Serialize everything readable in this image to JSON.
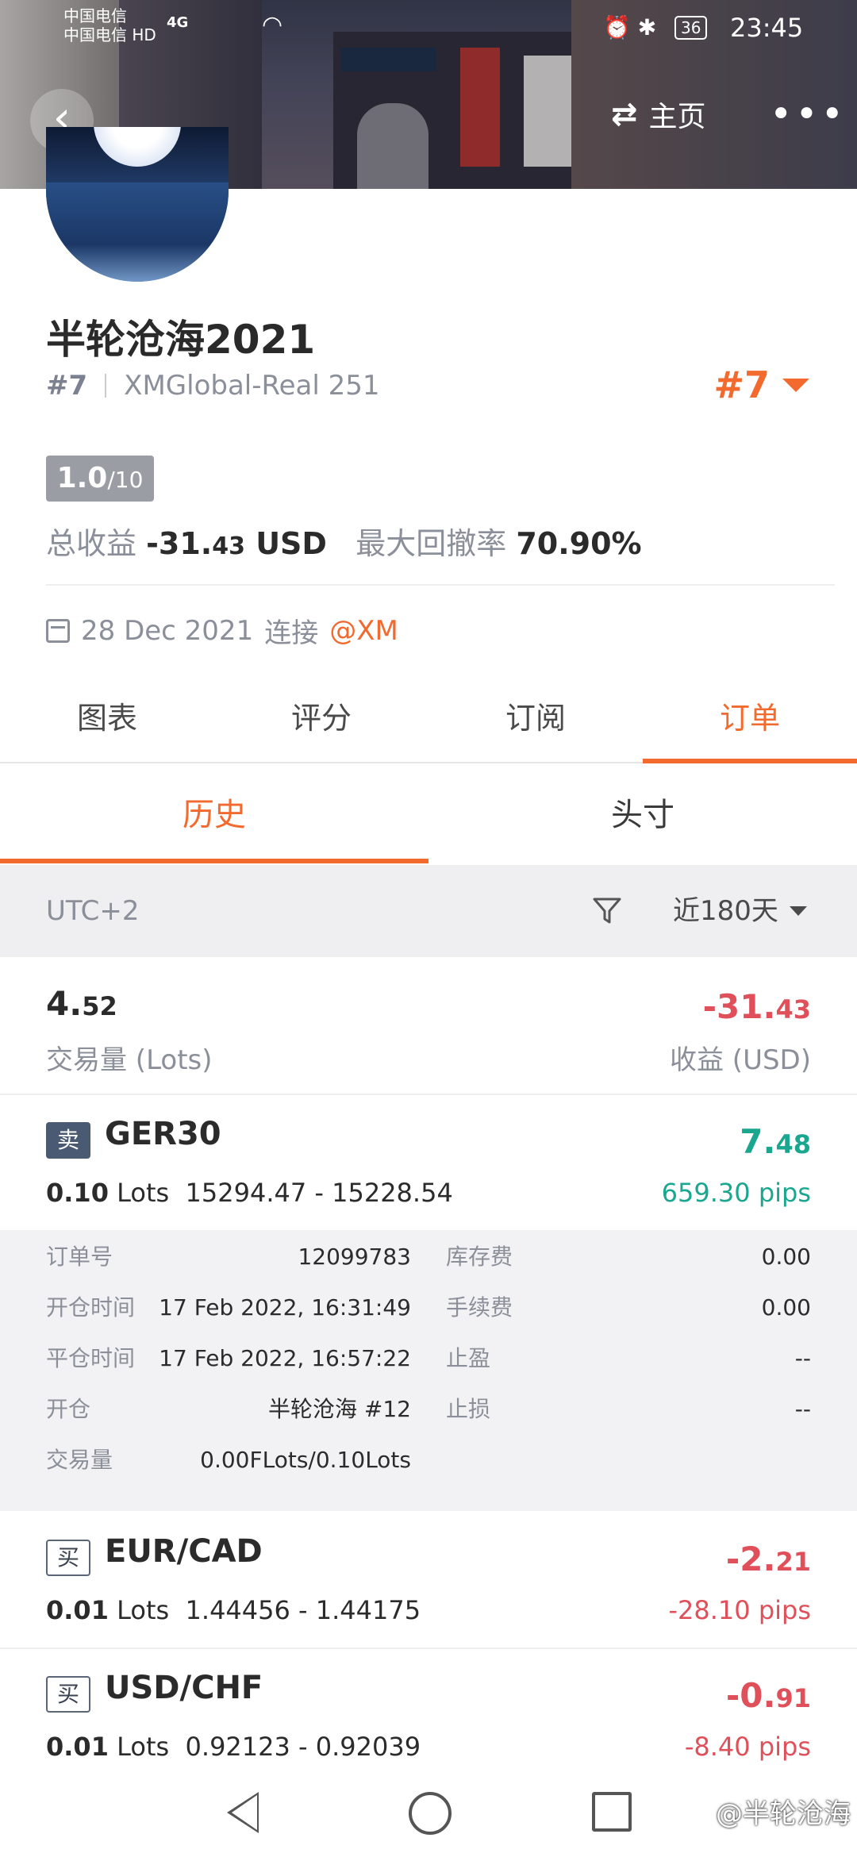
{
  "status_bar": {
    "carrier_1": "中国电信",
    "carrier_2": "中国电信",
    "hd": "HD",
    "signal": "4G",
    "battery": "36",
    "time": "23:45"
  },
  "header": {
    "home_label": "主页"
  },
  "profile": {
    "name": "半轮沧海2021",
    "rank": "#7",
    "server": "XMGlobal-Real 251",
    "rank_right": "#7",
    "score": "1.0",
    "score_max": "/10",
    "total_profit_label": "总收益",
    "total_profit_main": "-31.",
    "total_profit_dec": "43",
    "total_profit_unit": "USD",
    "drawdown_label": "最大回撤率",
    "drawdown_value": "70.90%",
    "connected_date": "28 Dec 2021",
    "connected_label": "连接",
    "broker": "@XM"
  },
  "tabs": [
    "图表",
    "评分",
    "订阅",
    "订单"
  ],
  "subtabs": [
    "历史",
    "头寸"
  ],
  "filter": {
    "timezone": "UTC+2",
    "range": "近180天"
  },
  "summary": {
    "lots_main": "4.",
    "lots_dec": "52",
    "lots_label": "交易量 (Lots)",
    "profit_main": "-31.",
    "profit_dec": "43",
    "profit_label": "收益 (USD)"
  },
  "orders": [
    {
      "side": "卖",
      "symbol": "GER30",
      "lots": "0.10",
      "lots_unit": "Lots",
      "prices": "15294.47 - 15228.54",
      "profit_main": "7.",
      "profit_dec": "48",
      "pips": "659.30 pips"
    },
    {
      "side": "买",
      "symbol": "EUR/CAD",
      "lots": "0.01",
      "lots_unit": "Lots",
      "prices": "1.44456 - 1.44175",
      "profit_main": "-2.",
      "profit_dec": "21",
      "pips": "-28.10 pips"
    },
    {
      "side": "买",
      "symbol": "USD/CHF",
      "lots": "0.01",
      "lots_unit": "Lots",
      "prices": "0.92123 - 0.92039",
      "profit_main": "-0.",
      "profit_dec": "91",
      "pips": "-8.40 pips"
    }
  ],
  "order_detail": {
    "order_no_label": "订单号",
    "order_no": "12099783",
    "swap_label": "库存费",
    "swap": "0.00",
    "open_time_label": "开仓时间",
    "open_time": "17 Feb 2022, 16:31:49",
    "commission_label": "手续费",
    "commission": "0.00",
    "close_time_label": "平仓时间",
    "close_time": "17 Feb 2022, 16:57:22",
    "tp_label": "止盈",
    "tp": "--",
    "open_label": "开仓",
    "open_value": "半轮沧海  #12",
    "sl_label": "止损",
    "sl": "--",
    "volume_label": "交易量",
    "volume": "0.00FLots/0.10Lots"
  },
  "watermark": "@半轮沧海"
}
